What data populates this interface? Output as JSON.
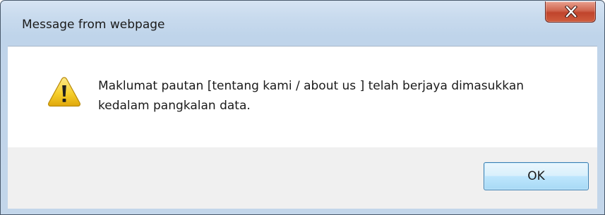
{
  "dialog": {
    "title": "Message from webpage",
    "close_symbol": "X",
    "message_line1": "Maklumat pautan [tentang kami / about us ] telah berjaya dimasukkan",
    "message_line2": "kedalam pangkalan data.",
    "icon": "warning-icon",
    "ok_label": "OK"
  },
  "colors": {
    "frame": "#c9dbee",
    "close_button": "#c9553b",
    "ok_button_border": "#3c7fb1",
    "button_area": "#f0f0f0",
    "warning_yellow": "#f2c41c"
  }
}
